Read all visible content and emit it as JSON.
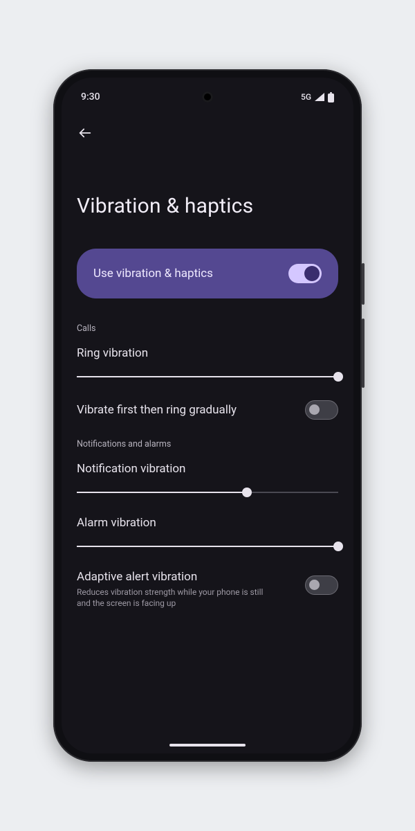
{
  "status": {
    "time": "9:30",
    "network": "5G"
  },
  "page": {
    "title": "Vibration & haptics"
  },
  "master": {
    "label": "Use vibration & haptics",
    "on": true
  },
  "sections": {
    "calls": {
      "heading": "Calls",
      "ring": {
        "label": "Ring vibration",
        "value": 100
      },
      "vibrateFirst": {
        "label": "Vibrate first then ring gradually",
        "on": false
      }
    },
    "notifs": {
      "heading": "Notifications and alarms",
      "notification": {
        "label": "Notification vibration",
        "value": 65
      },
      "alarm": {
        "label": "Alarm vibration",
        "value": 100
      },
      "adaptive": {
        "label": "Adaptive alert vibration",
        "sub": "Reduces vibration strength while your phone is still and the screen is facing up",
        "on": false
      }
    }
  }
}
